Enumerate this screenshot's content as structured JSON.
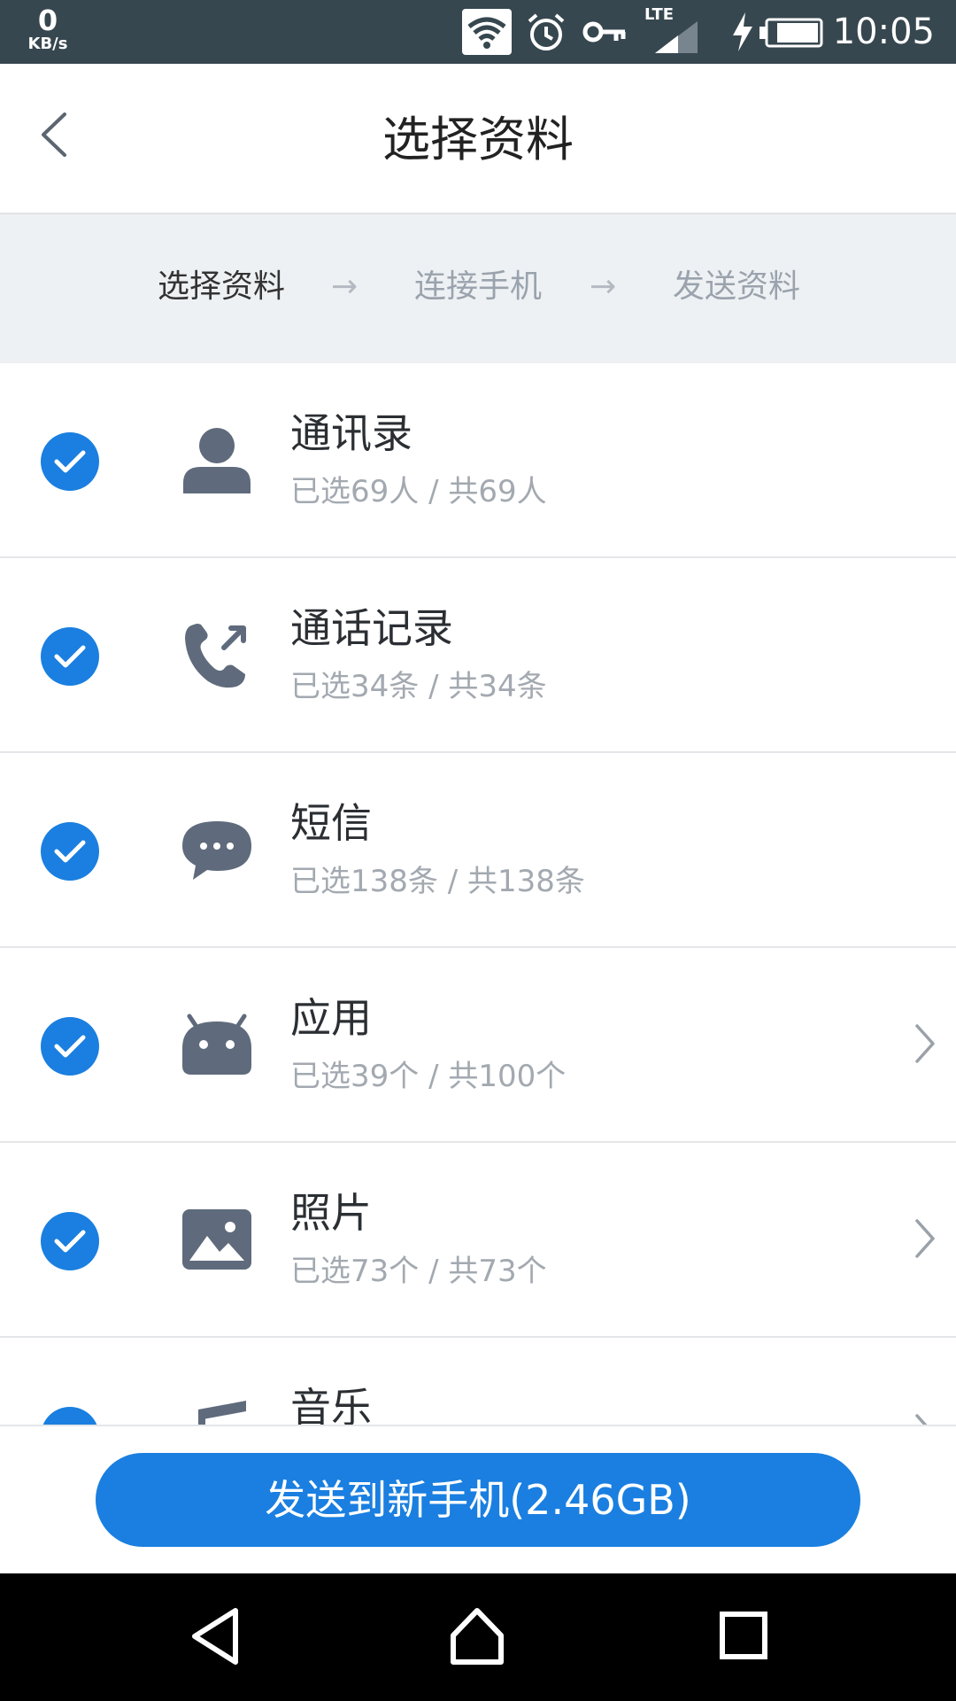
{
  "status_bar": {
    "net_speed": "0",
    "net_speed_unit": "KB/s",
    "network_type": "LTE",
    "time": "10:05"
  },
  "app_bar": {
    "title": "选择资料"
  },
  "steps": [
    {
      "label": "选择资料",
      "state": "active"
    },
    {
      "label": "连接手机",
      "state": "inactive"
    },
    {
      "label": "发送资料",
      "state": "inactive"
    }
  ],
  "step_arrow": "→",
  "items": [
    {
      "title": "通讯录",
      "subtitle": "已选69人 / 共69人",
      "icon": "contact-icon",
      "checked": true,
      "has_detail": false
    },
    {
      "title": "通话记录",
      "subtitle": "已选34条 / 共34条",
      "icon": "call-log-icon",
      "checked": true,
      "has_detail": false
    },
    {
      "title": "短信",
      "subtitle": "已选138条 / 共138条",
      "icon": "sms-icon",
      "checked": true,
      "has_detail": false
    },
    {
      "title": "应用",
      "subtitle": "已选39个 / 共100个",
      "icon": "android-icon",
      "checked": true,
      "has_detail": true
    },
    {
      "title": "照片",
      "subtitle": "已选73个 / 共73个",
      "icon": "photo-icon",
      "checked": true,
      "has_detail": true
    },
    {
      "title": "音乐",
      "subtitle": "",
      "icon": "music-icon",
      "checked": true,
      "has_detail": true
    }
  ],
  "send_button": {
    "label": "发送到新手机(2.46GB)"
  },
  "colors": {
    "accent": "#1a7fe0",
    "status_bar": "#37474f",
    "icon_gray": "#5f6b7c",
    "steps_bg": "#eef1f4"
  }
}
